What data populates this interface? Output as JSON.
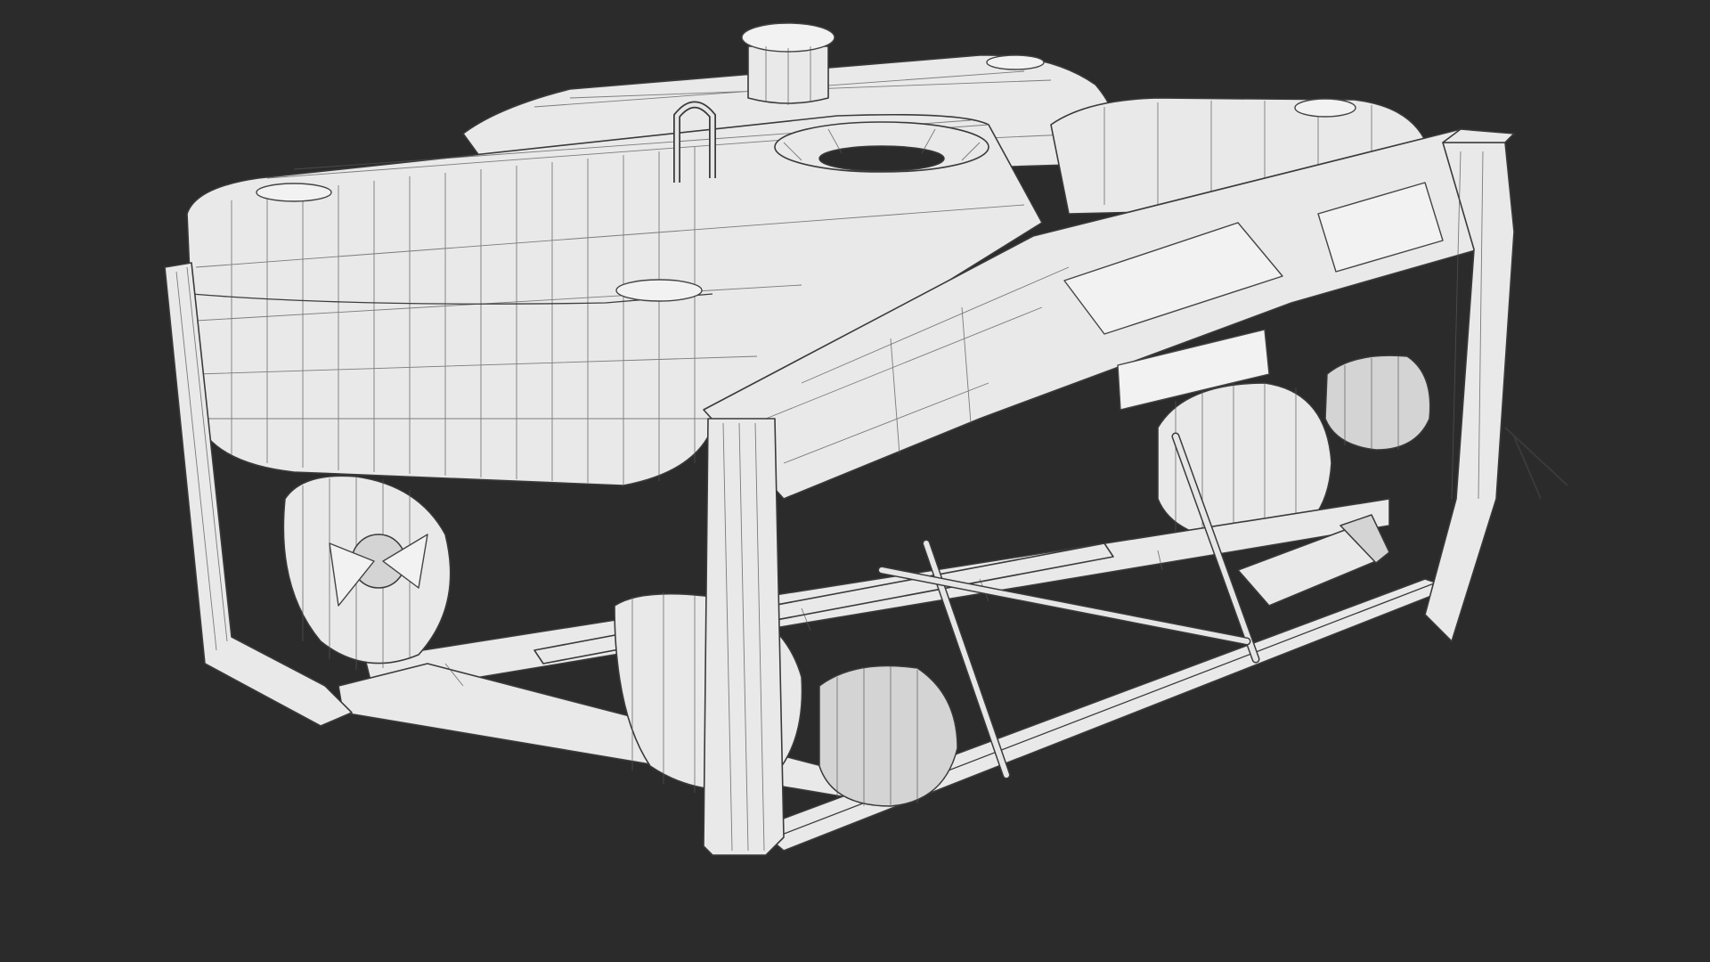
{
  "scene": {
    "background_color": "#2b2b2b",
    "mesh_color": "#e9e9e9",
    "wire_color": "#3a3a3a",
    "subject": "rov-wireframe-model"
  }
}
